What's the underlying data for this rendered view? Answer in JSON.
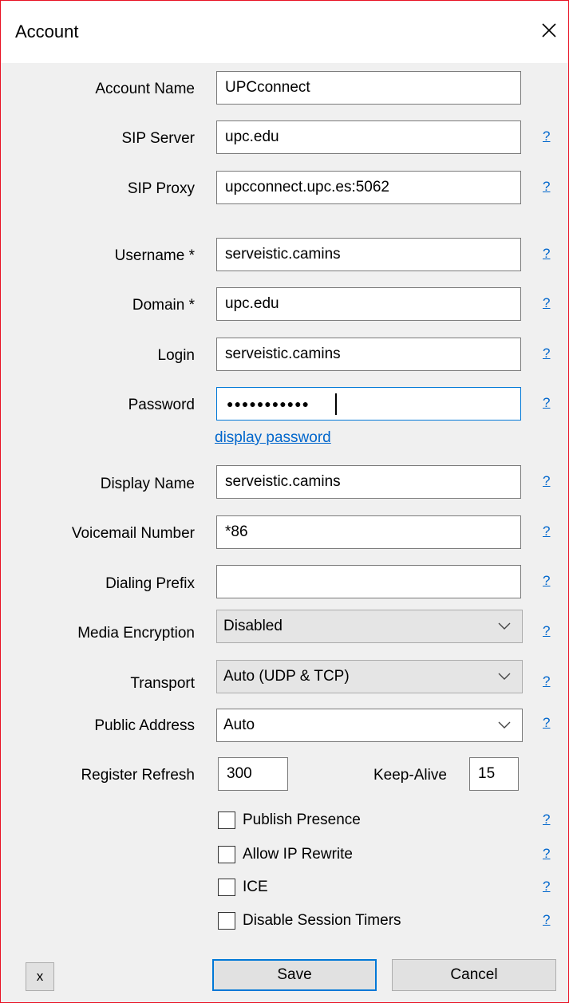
{
  "window": {
    "title": "Account"
  },
  "fields": {
    "account_name": {
      "label": "Account Name",
      "value": "UPCconnect"
    },
    "sip_server": {
      "label": "SIP Server",
      "value": "upc.edu"
    },
    "sip_proxy": {
      "label": "SIP Proxy",
      "value": "upcconnect.upc.es:5062"
    },
    "username": {
      "label": "Username *",
      "value": "serveistic.camins"
    },
    "domain": {
      "label": "Domain *",
      "value": "upc.edu"
    },
    "login": {
      "label": "Login",
      "value": "serveistic.camins"
    },
    "password": {
      "label": "Password",
      "value": "●●●●●●●●●●●"
    },
    "display_password_link": "display password",
    "display_name": {
      "label": "Display Name",
      "value": "serveistic.camins"
    },
    "voicemail_number": {
      "label": "Voicemail Number",
      "value": "*86"
    },
    "dialing_prefix": {
      "label": "Dialing Prefix",
      "value": ""
    },
    "media_encryption": {
      "label": "Media Encryption",
      "value": "Disabled"
    },
    "transport": {
      "label": "Transport",
      "value": "Auto (UDP & TCP)"
    },
    "public_address": {
      "label": "Public Address",
      "value": "Auto"
    },
    "register_refresh": {
      "label": "Register Refresh",
      "value": "300"
    },
    "keep_alive": {
      "label": "Keep-Alive",
      "value": "15"
    }
  },
  "help_label": "?",
  "checkboxes": {
    "publish_presence": {
      "label": "Publish Presence",
      "checked": false
    },
    "allow_ip_rewrite": {
      "label": "Allow IP Rewrite",
      "checked": false
    },
    "ice": {
      "label": "ICE",
      "checked": false
    },
    "disable_session_timers": {
      "label": "Disable Session Timers",
      "checked": false
    }
  },
  "buttons": {
    "x": "x",
    "save": "Save",
    "cancel": "Cancel"
  }
}
